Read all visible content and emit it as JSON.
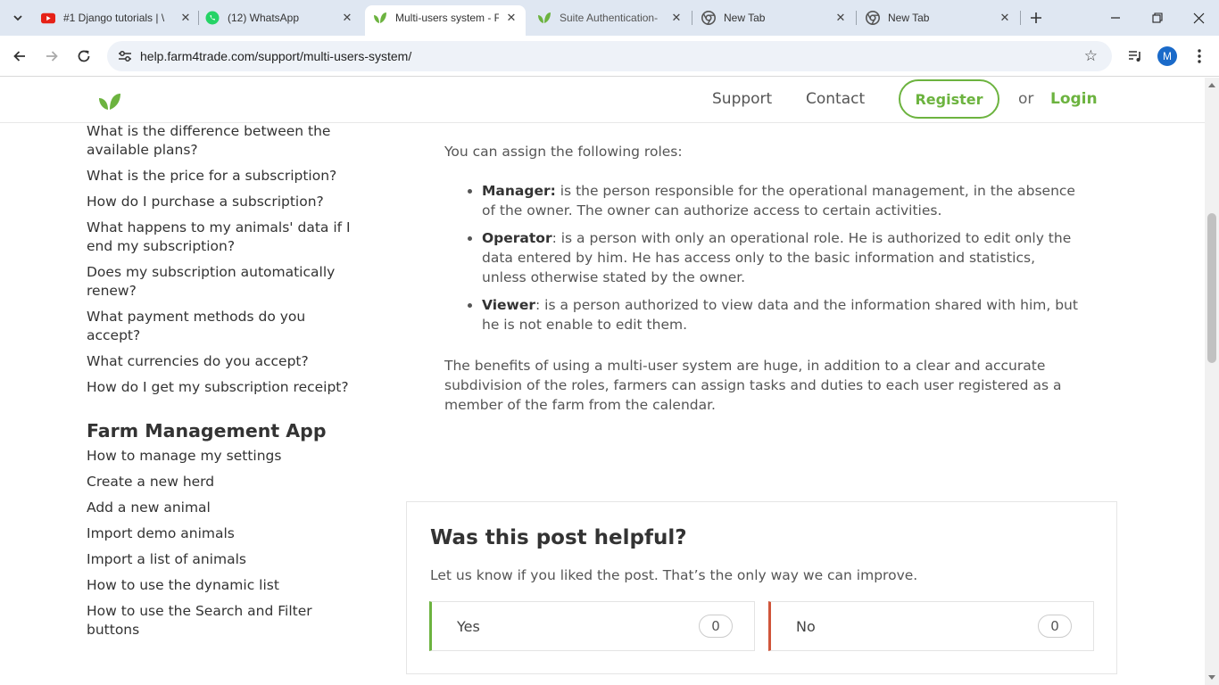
{
  "browser": {
    "tabs": [
      {
        "title": "#1 Django tutorials | \\",
        "icon": "youtube-icon"
      },
      {
        "title": "(12) WhatsApp",
        "icon": "whatsapp-icon"
      },
      {
        "title": "Multi-users system - F",
        "icon": "farm4trade-leaf-icon"
      },
      {
        "title": "Suite Authentication-",
        "icon": "farm4trade-leaf-icon"
      },
      {
        "title": "New Tab",
        "icon": "chrome-icon"
      },
      {
        "title": "New Tab",
        "icon": "chrome-icon"
      }
    ],
    "url": "help.farm4trade.com/support/multi-users-system/",
    "profile_initial": "M"
  },
  "site": {
    "nav": {
      "support": "Support",
      "contact": "Contact",
      "register": "Register",
      "or": "or",
      "login": "Login"
    },
    "brand_color": "#6cb33f"
  },
  "sidebar": {
    "subscription_links": [
      "What is the difference between the available plans?",
      "What is the price for a subscription?",
      "How do I purchase a subscription?",
      "What happens to my animals' data if I end my subscription?",
      "Does my subscription automatically renew?",
      "What payment methods do you accept?",
      "What currencies do you accept?",
      "How do I get my subscription receipt?"
    ],
    "section_heading": "Farm Management App",
    "app_links": [
      "How to manage my settings",
      "Create a new herd",
      "Add a new animal",
      "Import demo animals",
      "Import a list of animals",
      "How to use the dynamic list",
      "How to use the Search and Filter buttons"
    ]
  },
  "article": {
    "intro": "You can assign the following roles:",
    "roles": [
      {
        "name": "Manager:",
        "text": " is the person responsible for the operational management, in the absence of the owner. The owner can authorize access to certain activities."
      },
      {
        "name": "Operator",
        "text": ": is a person with only an operational role. He is authorized to edit only the data entered by him. He has access only to the basic information and statistics, unless otherwise stated by the owner."
      },
      {
        "name": "Viewer",
        "text": ": is a person authorized to view data and the information shared with him, but he is not enable to edit them."
      }
    ],
    "benefits": "The benefits of using a multi-user system are huge, in addition to a clear and accurate subdivision of the roles, farmers can assign tasks and duties to each user registered as a member of the farm from the calendar."
  },
  "feedback": {
    "title": "Was this post helpful?",
    "subtitle": "Let us know if you liked the post. That’s the only way we can improve.",
    "yes_label": "Yes",
    "yes_count": "0",
    "no_label": "No",
    "no_count": "0"
  }
}
